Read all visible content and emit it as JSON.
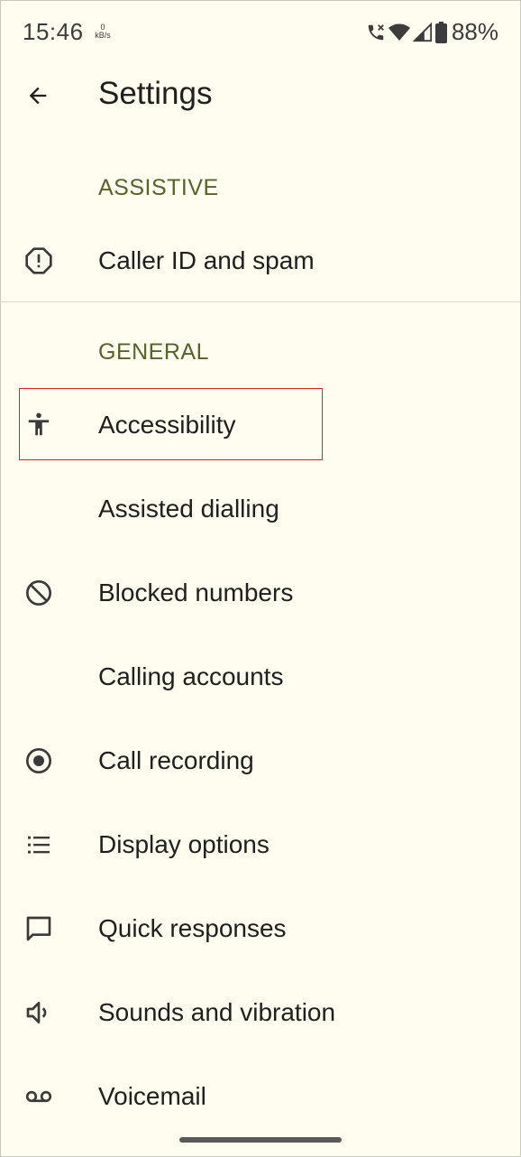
{
  "status_bar": {
    "time": "15:46",
    "net_speed_value": "0",
    "net_speed_unit": "kB/s",
    "battery": "88%"
  },
  "app_bar": {
    "title": "Settings"
  },
  "sections": {
    "assistive": "ASSISTIVE",
    "general": "GENERAL"
  },
  "items": {
    "caller_id": "Caller ID and spam",
    "accessibility": "Accessibility",
    "assisted_dialling": "Assisted dialling",
    "blocked_numbers": "Blocked numbers",
    "calling_accounts": "Calling accounts",
    "call_recording": "Call recording",
    "display_options": "Display options",
    "quick_responses": "Quick responses",
    "sounds_vibration": "Sounds and vibration",
    "voicemail": "Voicemail"
  },
  "icons": {
    "back": "arrow-back-icon",
    "caller_id": "alert-circle-icon",
    "accessibility": "accessibility-person-icon",
    "blocked_numbers": "block-icon",
    "call_recording": "record-icon",
    "display_options": "list-icon",
    "quick_responses": "chat-bubble-icon",
    "sounds_vibration": "volume-icon",
    "voicemail": "voicemail-icon"
  },
  "colors": {
    "background": "#fefdef",
    "section_header": "#56642a",
    "highlight": "#e02020"
  }
}
